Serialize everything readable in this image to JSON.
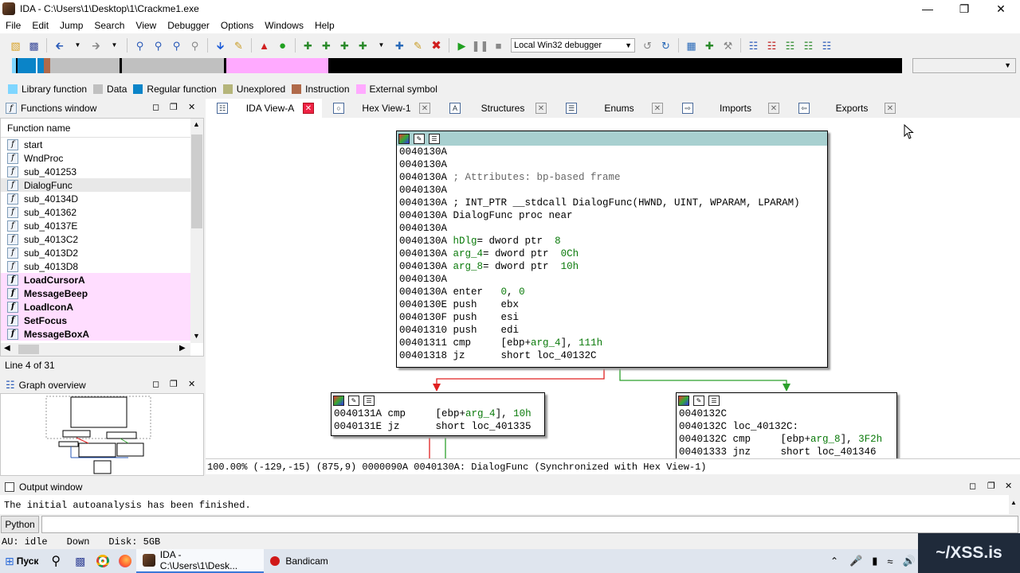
{
  "window": {
    "title": "IDA - C:\\Users\\1\\Desktop\\1\\Crackme1.exe"
  },
  "menu": [
    "File",
    "Edit",
    "Jump",
    "Search",
    "View",
    "Debugger",
    "Options",
    "Windows",
    "Help"
  ],
  "toolbar": {
    "debugger": "Local Win32 debugger"
  },
  "legend": [
    {
      "label": "Library function",
      "color": "#7fd6ff"
    },
    {
      "label": "Data",
      "color": "#c0c0c0"
    },
    {
      "label": "Regular function",
      "color": "#0a84c8"
    },
    {
      "label": "Unexplored",
      "color": "#b5b57a"
    },
    {
      "label": "Instruction",
      "color": "#b06a4a"
    },
    {
      "label": "External symbol",
      "color": "#ffaaff"
    }
  ],
  "functions_window": {
    "title": "Functions window",
    "column": "Function name",
    "items": [
      {
        "name": "start",
        "ext": false
      },
      {
        "name": "WndProc",
        "ext": false
      },
      {
        "name": "sub_401253",
        "ext": false
      },
      {
        "name": "DialogFunc",
        "ext": false,
        "sel": true
      },
      {
        "name": "sub_40134D",
        "ext": false
      },
      {
        "name": "sub_401362",
        "ext": false
      },
      {
        "name": "sub_40137E",
        "ext": false
      },
      {
        "name": "sub_4013C2",
        "ext": false
      },
      {
        "name": "sub_4013D2",
        "ext": false
      },
      {
        "name": "sub_4013D8",
        "ext": false
      },
      {
        "name": "LoadCursorA",
        "ext": true
      },
      {
        "name": "MessageBeep",
        "ext": true
      },
      {
        "name": "LoadIconA",
        "ext": true
      },
      {
        "name": "SetFocus",
        "ext": true
      },
      {
        "name": "MessageBoxA",
        "ext": true
      }
    ],
    "line_info": "Line 4 of 31"
  },
  "graph_overview": {
    "title": "Graph overview"
  },
  "tabs": [
    {
      "label": "IDA View-A",
      "icon": "graph-icon",
      "active": true
    },
    {
      "label": "Hex View-1",
      "icon": "hex-icon"
    },
    {
      "label": "Structures",
      "icon": "struct-icon"
    },
    {
      "label": "Enums",
      "icon": "enum-icon"
    },
    {
      "label": "Imports",
      "icon": "import-icon"
    },
    {
      "label": "Exports",
      "icon": "export-icon"
    }
  ],
  "nodes": {
    "main": [
      [
        [
          "a",
          "0040130A"
        ]
      ],
      [
        [
          "a",
          "0040130A"
        ]
      ],
      [
        [
          "a",
          "0040130A "
        ],
        [
          "c",
          "; Attributes: bp-based frame"
        ]
      ],
      [
        [
          "a",
          "0040130A"
        ]
      ],
      [
        [
          "a",
          "0040130A "
        ],
        [
          "t",
          "; INT_PTR __stdcall DialogFunc(HWND, UINT, WPARAM, LPARAM)"
        ]
      ],
      [
        [
          "a",
          "0040130A "
        ],
        [
          "t",
          "DialogFunc proc near"
        ]
      ],
      [
        [
          "a",
          "0040130A"
        ]
      ],
      [
        [
          "a",
          "0040130A "
        ],
        [
          "v",
          "hDlg"
        ],
        [
          "t",
          "= dword ptr  "
        ],
        [
          "n",
          "8"
        ]
      ],
      [
        [
          "a",
          "0040130A "
        ],
        [
          "v",
          "arg_4"
        ],
        [
          "t",
          "= dword ptr  "
        ],
        [
          "n",
          "0Ch"
        ]
      ],
      [
        [
          "a",
          "0040130A "
        ],
        [
          "v",
          "arg_8"
        ],
        [
          "t",
          "= dword ptr  "
        ],
        [
          "n",
          "10h"
        ]
      ],
      [
        [
          "a",
          "0040130A"
        ]
      ],
      [
        [
          "a",
          "0040130A "
        ],
        [
          "t",
          "enter   "
        ],
        [
          "n",
          "0"
        ],
        [
          "t",
          ", "
        ],
        [
          "n",
          "0"
        ]
      ],
      [
        [
          "a",
          "0040130E "
        ],
        [
          "t",
          "push    ebx"
        ]
      ],
      [
        [
          "a",
          "0040130F "
        ],
        [
          "t",
          "push    esi"
        ]
      ],
      [
        [
          "a",
          "00401310 "
        ],
        [
          "t",
          "push    edi"
        ]
      ],
      [
        [
          "a",
          "00401311 "
        ],
        [
          "t",
          "cmp     [ebp+"
        ],
        [
          "v",
          "arg_4"
        ],
        [
          "t",
          "], "
        ],
        [
          "n",
          "111h"
        ]
      ],
      [
        [
          "a",
          "00401318 "
        ],
        [
          "t",
          "jz      short loc_40132C"
        ]
      ]
    ],
    "left": [
      [
        [
          "a",
          "0040131A "
        ],
        [
          "t",
          "cmp     [ebp+"
        ],
        [
          "v",
          "arg_4"
        ],
        [
          "t",
          "], "
        ],
        [
          "n",
          "10h"
        ]
      ],
      [
        [
          "a",
          "0040131E "
        ],
        [
          "t",
          "jz      short loc_401335"
        ]
      ]
    ],
    "right": [
      [
        [
          "a",
          "0040132C"
        ]
      ],
      [
        [
          "a",
          "0040132C "
        ],
        [
          "t",
          "loc_40132C:"
        ]
      ],
      [
        [
          "a",
          "0040132C "
        ],
        [
          "t",
          "cmp     [ebp+"
        ],
        [
          "v",
          "arg_8"
        ],
        [
          "t",
          "], "
        ],
        [
          "n",
          "3F2h"
        ]
      ],
      [
        [
          "a",
          "00401333 "
        ],
        [
          "t",
          "jnz     short loc_401346"
        ]
      ]
    ]
  },
  "status_line": "100.00% (-129,-15) (875,9) 0000090A 0040130A: DialogFunc (Synchronized with Hex View-1)",
  "output_window": {
    "title": "Output window",
    "text": "The initial autoanalysis has been finished.",
    "python_label": "Python"
  },
  "ida_status": {
    "au": "AU:  idle",
    "dir": "Down",
    "disk": "Disk: 5GB"
  },
  "taskbar": {
    "start_label": "Пуск",
    "tasks": [
      {
        "label": "IDA - C:\\Users\\1\\Desk...",
        "active": true
      },
      {
        "label": "Bandicam",
        "active": false
      }
    ]
  },
  "watermark": "~/XSS.is",
  "colors": {
    "node_header": "#a8d0d0",
    "external_bg": "#ffddff",
    "true_edge": "#2ca02c",
    "false_edge": "#e02020"
  }
}
